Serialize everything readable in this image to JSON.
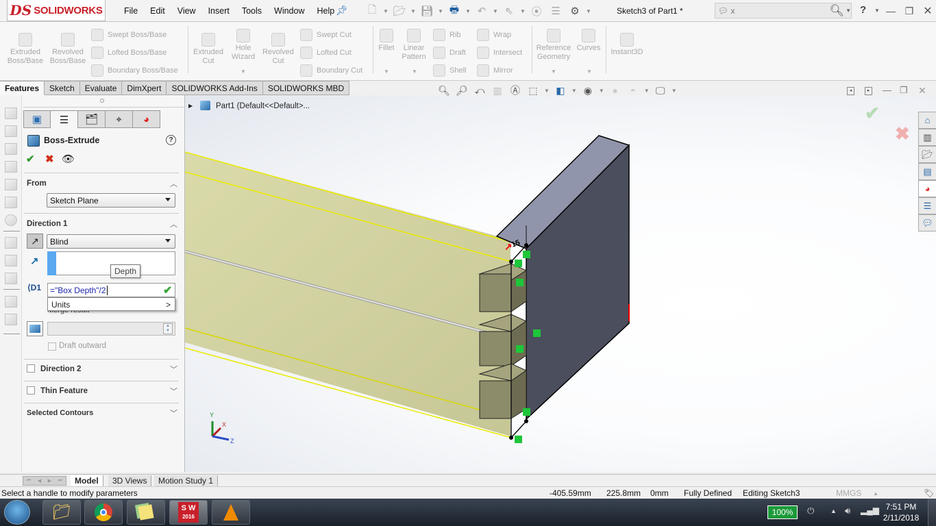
{
  "app": {
    "logo_ds": "DS",
    "logo_text": "SOLIDWORKS",
    "document_title": "Sketch3 of Part1 *"
  },
  "menu": [
    "File",
    "Edit",
    "View",
    "Insert",
    "Tools",
    "Window",
    "Help"
  ],
  "search": {
    "value": "x",
    "placeholder": ""
  },
  "help_label": "?",
  "command_manager": {
    "tools_large": [
      {
        "label1": "Extruded",
        "label2": "Boss/Base"
      },
      {
        "label1": "Revolved",
        "label2": "Boss/Base"
      },
      {
        "label1": "Extruded",
        "label2": "Cut"
      },
      {
        "label1": "Hole",
        "label2": "Wizard"
      },
      {
        "label1": "Revolved",
        "label2": "Cut"
      },
      {
        "label1": "Fillet",
        "label2": ""
      },
      {
        "label1": "Linear",
        "label2": "Pattern"
      },
      {
        "label1": "Reference",
        "label2": "Geometry"
      },
      {
        "label1": "Curves",
        "label2": ""
      },
      {
        "label1": "Instant3D",
        "label2": ""
      }
    ],
    "tools_small": [
      "Swept Boss/Base",
      "Lofted Boss/Base",
      "Boundary Boss/Base",
      "Swept Cut",
      "Lofted Cut",
      "Boundary Cut",
      "Rib",
      "Draft",
      "Shell",
      "Wrap",
      "Intersect",
      "Mirror"
    ],
    "tabs": [
      "Features",
      "Sketch",
      "Evaluate",
      "DimXpert",
      "SOLIDWORKS Add-Ins",
      "SOLIDWORKS MBD"
    ],
    "active_tab": "Features"
  },
  "feature_tree": {
    "root": "Part1  (Default<<Default>..."
  },
  "property_manager": {
    "title": "Boss-Extrude",
    "from": {
      "label": "From",
      "value": "Sketch Plane"
    },
    "direction1": {
      "label": "Direction 1",
      "end_condition": "Blind",
      "depth_equation": "=\"Box Depth\"/2",
      "tooltip": "Depth",
      "units_menu": "Units",
      "units_arrow": ">",
      "merge_result": "Merge result",
      "draft_outward": "Draft outward"
    },
    "direction2": {
      "label": "Direction 2",
      "checked": false
    },
    "thin_feature": {
      "label": "Thin Feature",
      "checked": false
    },
    "selected_contours": {
      "label": "Selected Contours"
    }
  },
  "triad": {
    "x": "X",
    "y": "Y",
    "z": "Z"
  },
  "sketch_dimension": "15",
  "bottom_tabs": [
    "Model",
    "3D Views",
    "Motion Study 1"
  ],
  "status": {
    "message": "Select a handle to modify parameters",
    "x": "-405.59mm",
    "y": "225.8mm",
    "z": "0mm",
    "definition": "Fully Defined",
    "mode": "Editing Sketch3",
    "units": "MMGS",
    "units_arrow": "▲"
  },
  "taskbar": {
    "battery": "100%",
    "time": "7:51 PM",
    "date": "2/11/2018",
    "sw_badge": "2016"
  },
  "colors": {
    "brand_red": "#c8202a",
    "sketch_yellow": "#e8e800",
    "relation_green": "#1ec63a",
    "preview_fill": "#c9c98c",
    "body_side": "#4b4e5c",
    "body_top": "#8f93a8"
  }
}
